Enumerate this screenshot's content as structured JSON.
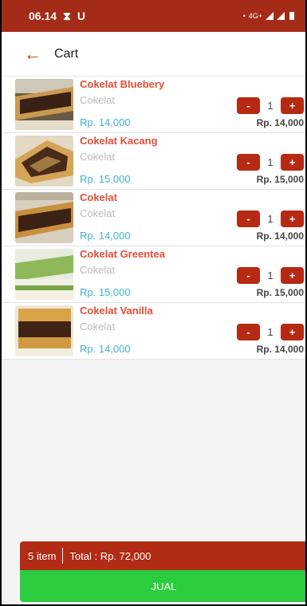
{
  "status_bar": {
    "time": "06.14",
    "network": "4G+"
  },
  "app_bar": {
    "title": "Cart"
  },
  "cart_items": [
    {
      "name": "Cokelat Bluebery",
      "category": "Cokelat",
      "price": "Rp. 14,000",
      "qty": "1",
      "subtotal": "Rp. 14,000",
      "minus": "-",
      "plus": "+"
    },
    {
      "name": "Cokelat Kacang",
      "category": "Cokelat",
      "price": "Rp. 15,000",
      "qty": "1",
      "subtotal": "Rp. 15,000",
      "minus": "-",
      "plus": "+"
    },
    {
      "name": "Cokelat",
      "category": "Cokelat",
      "price": "Rp. 14,000",
      "qty": "1",
      "subtotal": "Rp. 14,000",
      "minus": "-",
      "plus": "+"
    },
    {
      "name": "Cokelat Greentea",
      "category": "Cokelat",
      "price": "Rp. 15,000",
      "qty": "1",
      "subtotal": "Rp. 15,000",
      "minus": "-",
      "plus": "+"
    },
    {
      "name": "Cokelat Vanilla",
      "category": "Cokelat",
      "price": "Rp. 14,000",
      "qty": "1",
      "subtotal": "Rp. 14,000",
      "minus": "-",
      "plus": "+"
    }
  ],
  "summary": {
    "item_count": "5 item",
    "total": "Total : Rp. 72,000"
  },
  "checkout_button": {
    "label": "JUAL"
  },
  "colors": {
    "accent": "#a42b17",
    "title_red": "#e44d38",
    "price_blue": "#3fb3d6",
    "button_green": "#2ccc3f"
  }
}
